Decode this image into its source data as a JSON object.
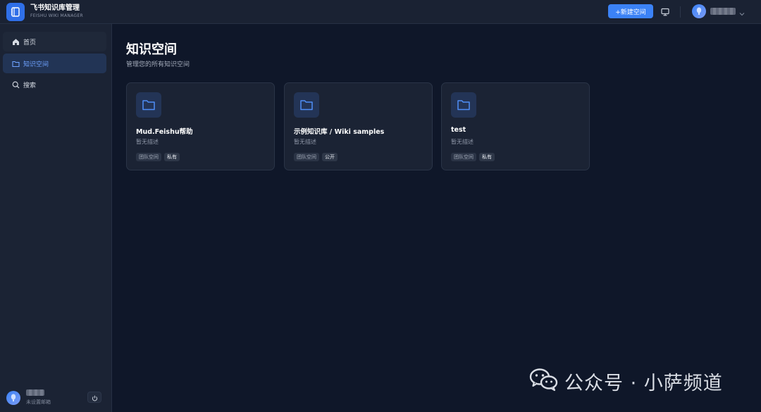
{
  "app": {
    "title": "飞书知识库管理",
    "subtitle": "FEISHU WIKI MANAGER"
  },
  "header": {
    "new_space_label": "+新建空间",
    "monitor_icon": "monitor-icon",
    "chevron_icon": "chevron-down-icon"
  },
  "sidebar": {
    "items": [
      {
        "label": "首页",
        "icon": "home-icon",
        "active": false
      },
      {
        "label": "知识空间",
        "icon": "folder-icon",
        "active": true
      },
      {
        "label": "搜索",
        "icon": "search-icon",
        "active": false
      }
    ],
    "user": {
      "email_status": "未设置邮箱",
      "logout_icon": "power-icon"
    }
  },
  "main": {
    "title": "知识空间",
    "subtitle": "管理您的所有知识空间",
    "spaces": [
      {
        "name": "Mud.Feishu帮助",
        "description": "暂无描述",
        "type_tag": "团队空间",
        "access_tag": "私有"
      },
      {
        "name": "示例知识库 / Wiki samples",
        "description": "暂无描述",
        "type_tag": "团队空间",
        "access_tag": "公开"
      },
      {
        "name": "test",
        "description": "暂无描述",
        "type_tag": "团队空间",
        "access_tag": "私有"
      }
    ]
  },
  "watermark": {
    "text": "公众号 · 小萨频道"
  },
  "colors": {
    "accent": "#3b82f6",
    "background": "#0f1729",
    "panel": "#1b2334",
    "active_nav": "#223455"
  }
}
